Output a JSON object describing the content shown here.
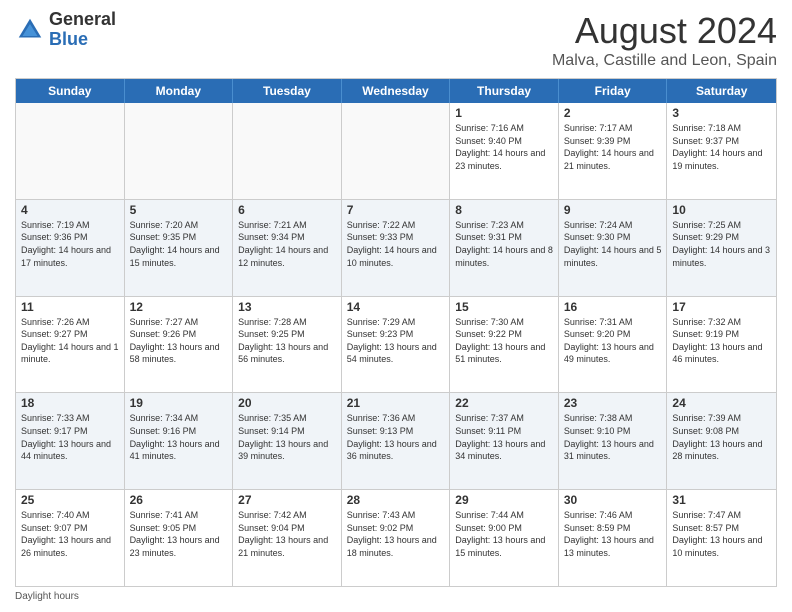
{
  "header": {
    "logo_general": "General",
    "logo_blue": "Blue",
    "month_title": "August 2024",
    "location": "Malva, Castille and Leon, Spain"
  },
  "days_of_week": [
    "Sunday",
    "Monday",
    "Tuesday",
    "Wednesday",
    "Thursday",
    "Friday",
    "Saturday"
  ],
  "weeks": [
    [
      {
        "day": "",
        "text": "",
        "empty": true
      },
      {
        "day": "",
        "text": "",
        "empty": true
      },
      {
        "day": "",
        "text": "",
        "empty": true
      },
      {
        "day": "",
        "text": "",
        "empty": true
      },
      {
        "day": "1",
        "text": "Sunrise: 7:16 AM\nSunset: 9:40 PM\nDaylight: 14 hours and 23 minutes.",
        "empty": false
      },
      {
        "day": "2",
        "text": "Sunrise: 7:17 AM\nSunset: 9:39 PM\nDaylight: 14 hours and 21 minutes.",
        "empty": false
      },
      {
        "day": "3",
        "text": "Sunrise: 7:18 AM\nSunset: 9:37 PM\nDaylight: 14 hours and 19 minutes.",
        "empty": false
      }
    ],
    [
      {
        "day": "4",
        "text": "Sunrise: 7:19 AM\nSunset: 9:36 PM\nDaylight: 14 hours and 17 minutes.",
        "empty": false
      },
      {
        "day": "5",
        "text": "Sunrise: 7:20 AM\nSunset: 9:35 PM\nDaylight: 14 hours and 15 minutes.",
        "empty": false
      },
      {
        "day": "6",
        "text": "Sunrise: 7:21 AM\nSunset: 9:34 PM\nDaylight: 14 hours and 12 minutes.",
        "empty": false
      },
      {
        "day": "7",
        "text": "Sunrise: 7:22 AM\nSunset: 9:33 PM\nDaylight: 14 hours and 10 minutes.",
        "empty": false
      },
      {
        "day": "8",
        "text": "Sunrise: 7:23 AM\nSunset: 9:31 PM\nDaylight: 14 hours and 8 minutes.",
        "empty": false
      },
      {
        "day": "9",
        "text": "Sunrise: 7:24 AM\nSunset: 9:30 PM\nDaylight: 14 hours and 5 minutes.",
        "empty": false
      },
      {
        "day": "10",
        "text": "Sunrise: 7:25 AM\nSunset: 9:29 PM\nDaylight: 14 hours and 3 minutes.",
        "empty": false
      }
    ],
    [
      {
        "day": "11",
        "text": "Sunrise: 7:26 AM\nSunset: 9:27 PM\nDaylight: 14 hours and 1 minute.",
        "empty": false
      },
      {
        "day": "12",
        "text": "Sunrise: 7:27 AM\nSunset: 9:26 PM\nDaylight: 13 hours and 58 minutes.",
        "empty": false
      },
      {
        "day": "13",
        "text": "Sunrise: 7:28 AM\nSunset: 9:25 PM\nDaylight: 13 hours and 56 minutes.",
        "empty": false
      },
      {
        "day": "14",
        "text": "Sunrise: 7:29 AM\nSunset: 9:23 PM\nDaylight: 13 hours and 54 minutes.",
        "empty": false
      },
      {
        "day": "15",
        "text": "Sunrise: 7:30 AM\nSunset: 9:22 PM\nDaylight: 13 hours and 51 minutes.",
        "empty": false
      },
      {
        "day": "16",
        "text": "Sunrise: 7:31 AM\nSunset: 9:20 PM\nDaylight: 13 hours and 49 minutes.",
        "empty": false
      },
      {
        "day": "17",
        "text": "Sunrise: 7:32 AM\nSunset: 9:19 PM\nDaylight: 13 hours and 46 minutes.",
        "empty": false
      }
    ],
    [
      {
        "day": "18",
        "text": "Sunrise: 7:33 AM\nSunset: 9:17 PM\nDaylight: 13 hours and 44 minutes.",
        "empty": false
      },
      {
        "day": "19",
        "text": "Sunrise: 7:34 AM\nSunset: 9:16 PM\nDaylight: 13 hours and 41 minutes.",
        "empty": false
      },
      {
        "day": "20",
        "text": "Sunrise: 7:35 AM\nSunset: 9:14 PM\nDaylight: 13 hours and 39 minutes.",
        "empty": false
      },
      {
        "day": "21",
        "text": "Sunrise: 7:36 AM\nSunset: 9:13 PM\nDaylight: 13 hours and 36 minutes.",
        "empty": false
      },
      {
        "day": "22",
        "text": "Sunrise: 7:37 AM\nSunset: 9:11 PM\nDaylight: 13 hours and 34 minutes.",
        "empty": false
      },
      {
        "day": "23",
        "text": "Sunrise: 7:38 AM\nSunset: 9:10 PM\nDaylight: 13 hours and 31 minutes.",
        "empty": false
      },
      {
        "day": "24",
        "text": "Sunrise: 7:39 AM\nSunset: 9:08 PM\nDaylight: 13 hours and 28 minutes.",
        "empty": false
      }
    ],
    [
      {
        "day": "25",
        "text": "Sunrise: 7:40 AM\nSunset: 9:07 PM\nDaylight: 13 hours and 26 minutes.",
        "empty": false
      },
      {
        "day": "26",
        "text": "Sunrise: 7:41 AM\nSunset: 9:05 PM\nDaylight: 13 hours and 23 minutes.",
        "empty": false
      },
      {
        "day": "27",
        "text": "Sunrise: 7:42 AM\nSunset: 9:04 PM\nDaylight: 13 hours and 21 minutes.",
        "empty": false
      },
      {
        "day": "28",
        "text": "Sunrise: 7:43 AM\nSunset: 9:02 PM\nDaylight: 13 hours and 18 minutes.",
        "empty": false
      },
      {
        "day": "29",
        "text": "Sunrise: 7:44 AM\nSunset: 9:00 PM\nDaylight: 13 hours and 15 minutes.",
        "empty": false
      },
      {
        "day": "30",
        "text": "Sunrise: 7:46 AM\nSunset: 8:59 PM\nDaylight: 13 hours and 13 minutes.",
        "empty": false
      },
      {
        "day": "31",
        "text": "Sunrise: 7:47 AM\nSunset: 8:57 PM\nDaylight: 13 hours and 10 minutes.",
        "empty": false
      }
    ]
  ],
  "footer": {
    "daylight_label": "Daylight hours"
  }
}
